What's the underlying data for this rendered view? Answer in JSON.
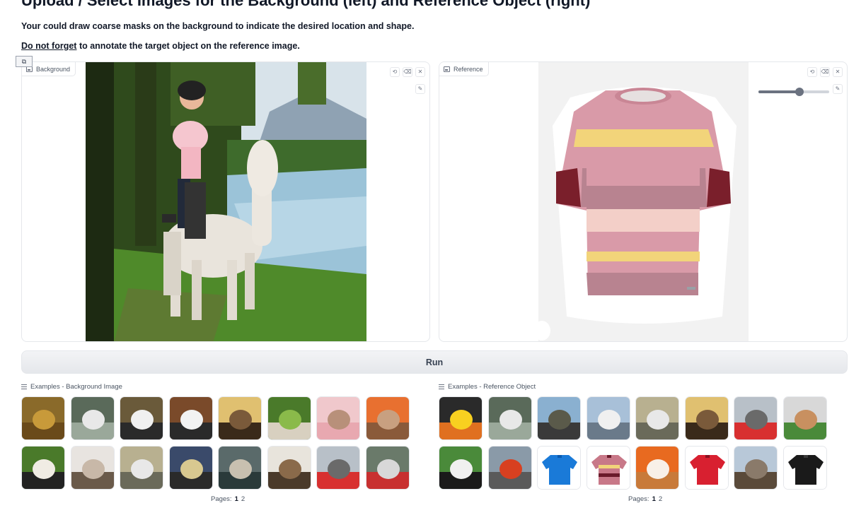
{
  "header": {
    "title": "Upload / Select Images for the Background (left) and Reference Object (right)",
    "desc1": "Your could draw coarse masks on the background to indicate the desired location and shape.",
    "desc2_underlined": "Do not forget",
    "desc2_rest": " to annotate the target object on the reference image."
  },
  "background_panel": {
    "label": "Background",
    "tools": {
      "undo": "⟲",
      "erase": "⌫",
      "close": "✕",
      "brush": "✎"
    }
  },
  "reference_panel": {
    "label": "Reference",
    "tools": {
      "undo": "⟲",
      "erase": "⌫",
      "close": "✕",
      "brush": "✎"
    },
    "brush_size_fraction": 0.58
  },
  "run_button": {
    "label": "Run"
  },
  "examples_background": {
    "label": "Examples - Background Image",
    "thumbnails": [
      "dog-photo",
      "white-dog-photo",
      "puppy-photo",
      "computer-desk-photo",
      "living-room-photo",
      "bird-photo",
      "cat-on-bed-photo",
      "cat-orange-photo",
      "girl-horse-photo",
      "people-table-photo",
      "blender-photo",
      "room-photo",
      "fireplace-room-photo",
      "dining-room-photo",
      "street-cars-photo",
      "bus-photo"
    ],
    "pages_label": "Pages:",
    "pages": [
      "1",
      "2"
    ],
    "current_page": "1"
  },
  "examples_reference": {
    "label": "Examples - Reference Object",
    "thumbnails": [
      "rubber-duck-photo",
      "white-dog-photo",
      "car-photo",
      "seagulls-photo",
      "blender-photo",
      "living-room-photo",
      "street-cars-photo",
      "taco-photo",
      "panda-photo",
      "fire-hydrant-photo",
      "blue-polo-photo",
      "striped-top-photo",
      "corgi-photo",
      "red-cardigan-photo",
      "sloth-plush-photo",
      "black-top-photo"
    ],
    "pages_label": "Pages:",
    "pages": [
      "1",
      "2"
    ],
    "current_page": "1"
  },
  "colors": {
    "accent": "#6b7280",
    "border": "#e5e7eb",
    "shirt_pink": "#d99aa8",
    "shirt_yellow": "#f2d47a",
    "shirt_maroon": "#7a1f2b"
  }
}
